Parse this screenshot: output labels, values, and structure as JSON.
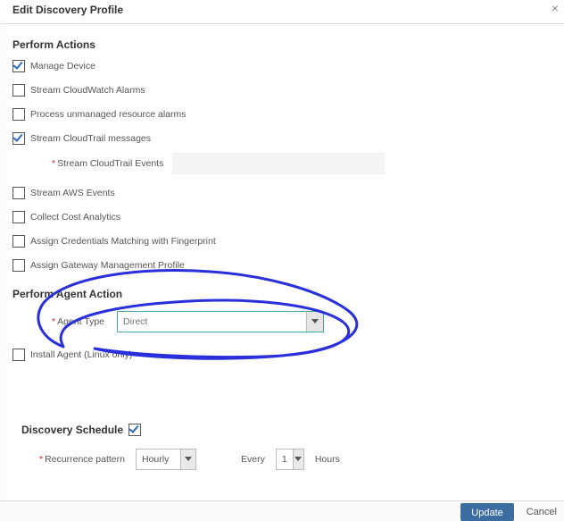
{
  "header": {
    "title": "Edit Discovery Profile"
  },
  "sections": {
    "actions": {
      "title": "Perform Actions",
      "items": [
        {
          "label": "Manage Device",
          "checked": true
        },
        {
          "label": "Stream CloudWatch Alarms",
          "checked": false
        },
        {
          "label": "Process unmanaged resource alarms",
          "checked": false
        },
        {
          "label": "Stream CloudTrail messages",
          "checked": true
        },
        {
          "label": "Stream AWS Events",
          "checked": false
        },
        {
          "label": "Collect Cost Analytics",
          "checked": false
        },
        {
          "label": "Assign Credentials Matching with Fingerprint",
          "checked": false
        },
        {
          "label": "Assign Gateway Management Profile",
          "checked": false
        }
      ],
      "cloudtrail_events_label": "Stream CloudTrail Events"
    },
    "agent": {
      "title": "Perform Agent Action",
      "agent_type_label": "Agent Type",
      "agent_type_value": "Direct",
      "install_label": "Install Agent (Linux only)",
      "install_checked": false
    },
    "schedule": {
      "title": "Discovery Schedule",
      "enabled": true,
      "recurrence_label": "Recurrence pattern",
      "recurrence_value": "Hourly",
      "every_label": "Every",
      "every_value": "1",
      "every_unit": "Hours"
    }
  },
  "footer": {
    "update": "Update",
    "cancel": "Cancel"
  }
}
